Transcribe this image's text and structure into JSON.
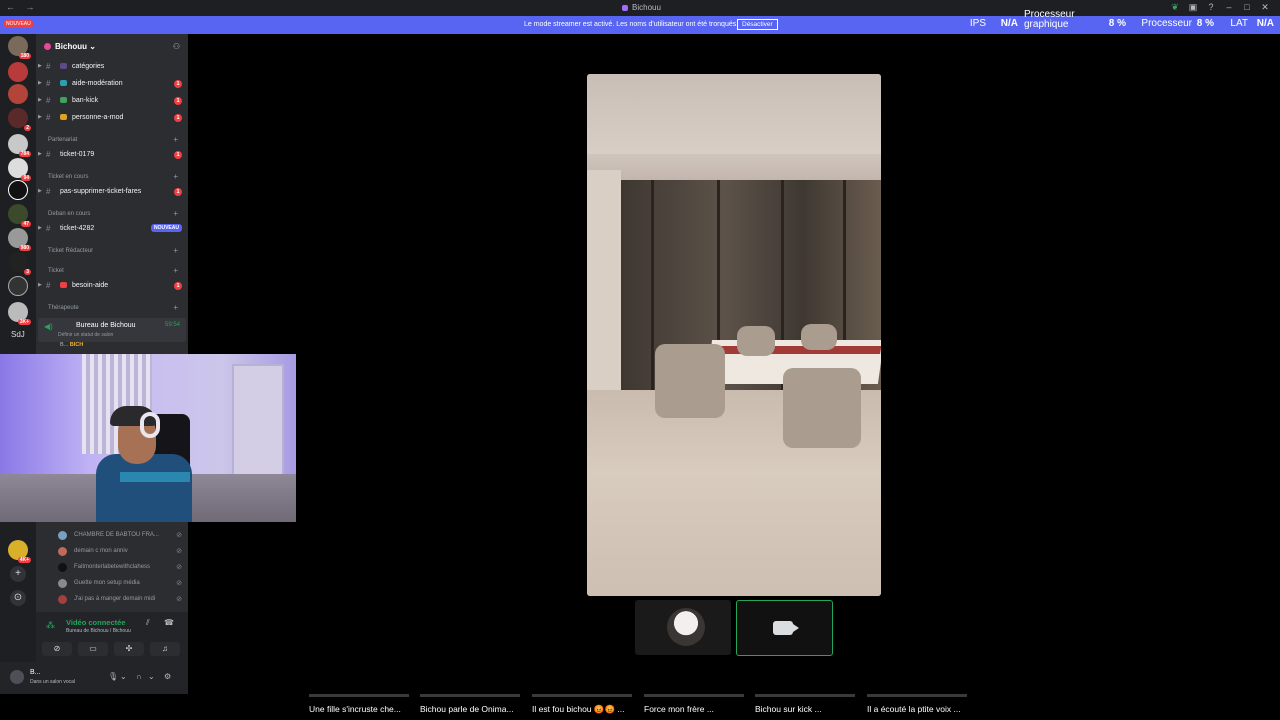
{
  "window": {
    "title": "Bichouu",
    "nav": "← →"
  },
  "banner": {
    "message": "Le mode streamer est activé. Les noms d'utilisateur ont été tronqués.",
    "button": "Désactiver"
  },
  "perf": {
    "ips_label": "IPS",
    "ips_value": "N/A",
    "gpu_label": "Processeur graphique",
    "gpu_value": "8 %",
    "cpu_label": "Processeur",
    "cpu_value": "8 %",
    "lat_label": "LAT",
    "lat_value": "N/A"
  },
  "rail": {
    "top_badge": "NOUVEAU",
    "badges": [
      "180",
      "",
      "",
      "2",
      "784",
      "94",
      "",
      "47",
      "980",
      "3",
      "",
      "3K+"
    ],
    "label": "SdJ",
    "bottom_badge": "4K+"
  },
  "server": {
    "name": "Bichouu",
    "chevron": "⌄"
  },
  "channels": [
    {
      "label": "catégories",
      "badge": ""
    },
    {
      "label": "aide-modération",
      "badge": "1"
    },
    {
      "label": "ban-kick",
      "badge": "1"
    },
    {
      "label": "personne-a-mod",
      "badge": "1"
    }
  ],
  "categories": {
    "partenariat": "Partenariat",
    "ticket_en_cours": "Ticket en cours",
    "deban_en_cours": "Deban en cours",
    "ticket_redacteur": "Ticket Rédacteur",
    "ticket": "Ticket",
    "therapeute": "Thérapeute"
  },
  "ticket_channels": {
    "ticket_0179": {
      "label": "ticket-0179",
      "badge": "1"
    },
    "pas_supprimer": {
      "label": "pas-supprimer-ticket-fares",
      "badge": "1"
    },
    "ticket_4282": {
      "label": "ticket-4282",
      "badge": "NOUVEAU"
    },
    "besoin_aide": {
      "label": "besoin-aide",
      "badge": "1"
    }
  },
  "voice_channel": {
    "label": "Bureau de Bichouu",
    "time": "59:54",
    "status": "Définir un statut de salon",
    "member": "B...",
    "member_tag": "BICH"
  },
  "voice_list": [
    {
      "label": "CHAMBRE DE BABTOU FRA..."
    },
    {
      "label": "demain c mon anniv"
    },
    {
      "label": "Faitmonterlabetewithclahess"
    },
    {
      "label": "Guette mon setup média"
    },
    {
      "label": "J'ai pas à manger demain midi"
    }
  ],
  "voice_panel": {
    "status": "Vidéo connectée",
    "sub": "Bureau de Bichouu / Bichouu"
  },
  "user_panel": {
    "name": "B...",
    "sub": "Dans un salon vocal"
  },
  "bottom_titles": [
    "Une fille s'incruste che...",
    "Bichou parle de Onima...",
    "Il est fou bichou 😡😡 ...",
    "Force mon frère ...",
    "Bichou sur kick ...",
    "Il a écouté la ptite voix ..."
  ],
  "colors": {
    "banner": "#5865f2",
    "accent_green": "#23a55a",
    "badge_red": "#f23f43",
    "sidebar": "#2b2d31",
    "rail": "#1e1f22"
  }
}
